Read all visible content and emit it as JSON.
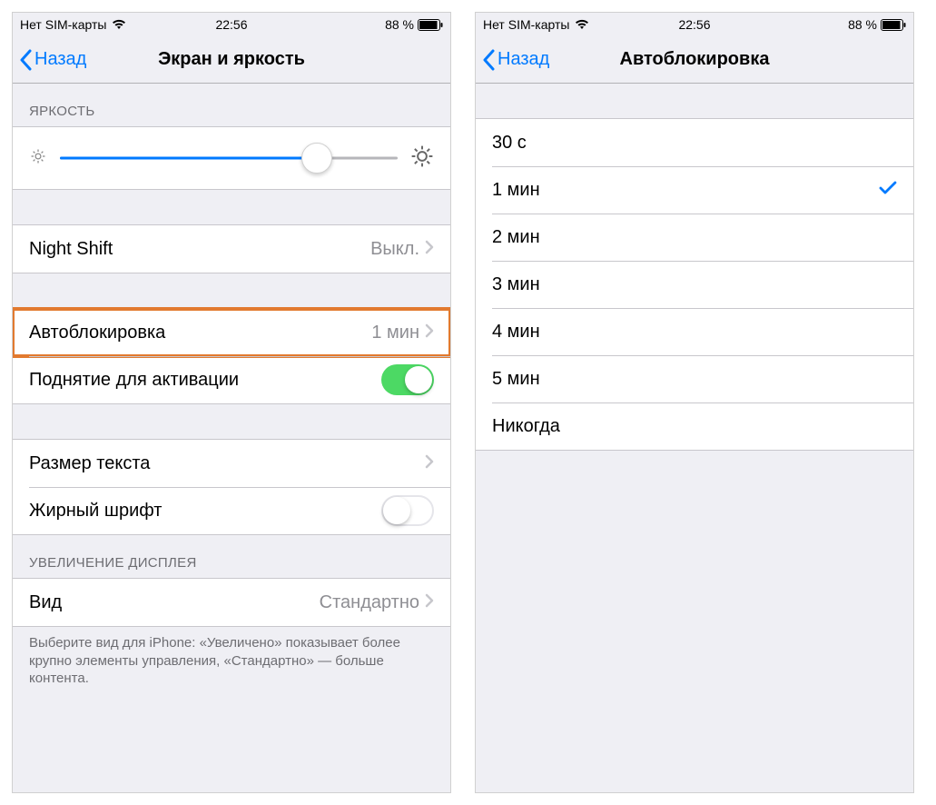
{
  "statusbar": {
    "carrier": "Нет SIM-карты",
    "time": "22:56",
    "battery_pct": "88 %"
  },
  "left_screen": {
    "back_label": "Назад",
    "title": "Экран и яркость",
    "brightness_header": "ЯРКОСТЬ",
    "brightness_value_pct": 76,
    "night_shift": {
      "label": "Night Shift",
      "value": "Выкл."
    },
    "autolock": {
      "label": "Автоблокировка",
      "value": "1 мин"
    },
    "raise_to_wake": {
      "label": "Поднятие для активации",
      "on": true
    },
    "text_size": {
      "label": "Размер текста"
    },
    "bold_text": {
      "label": "Жирный шрифт",
      "on": false
    },
    "display_zoom_header": "УВЕЛИЧЕНИЕ ДИСПЛЕЯ",
    "view": {
      "label": "Вид",
      "value": "Стандартно"
    },
    "view_footer": "Выберите вид для iPhone: «Увеличено» показывает более крупно элементы управления, «Стандартно» — больше контента."
  },
  "right_screen": {
    "back_label": "Назад",
    "title": "Автоблокировка",
    "options": [
      {
        "label": "30 с",
        "selected": false
      },
      {
        "label": "1 мин",
        "selected": true
      },
      {
        "label": "2 мин",
        "selected": false
      },
      {
        "label": "3 мин",
        "selected": false
      },
      {
        "label": "4 мин",
        "selected": false
      },
      {
        "label": "5 мин",
        "selected": false
      },
      {
        "label": "Никогда",
        "selected": false
      }
    ]
  }
}
